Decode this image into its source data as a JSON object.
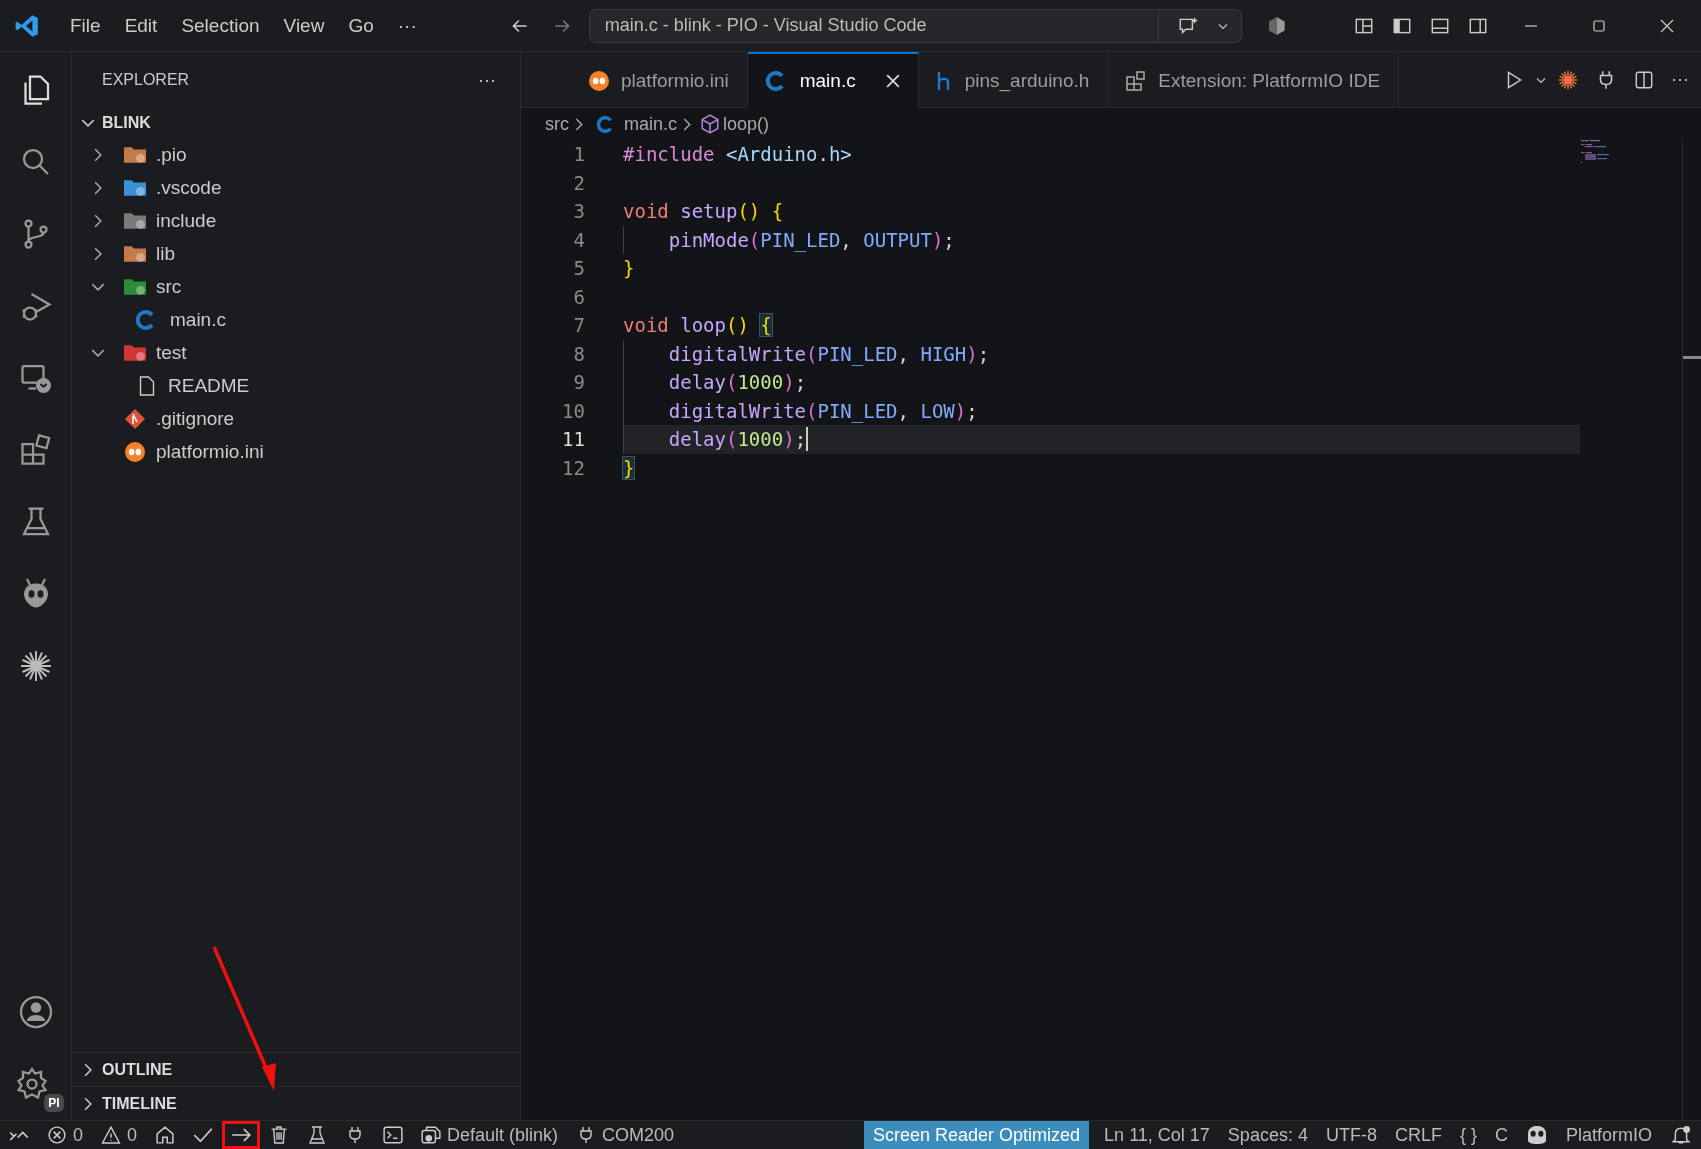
{
  "window": {
    "title": "main.c - blink - PIO - Visual Studio Code"
  },
  "menu": [
    "File",
    "Edit",
    "Selection",
    "View",
    "Go",
    "···"
  ],
  "sidebar": {
    "title": "EXPLORER",
    "more": "···",
    "root": {
      "label": "BLINK",
      "expanded": true
    },
    "items": [
      {
        "label": ".pio",
        "kind": "pio",
        "expanded": false
      },
      {
        "label": ".vscode",
        "kind": "vscode",
        "expanded": false
      },
      {
        "label": "include",
        "kind": "include",
        "expanded": false
      },
      {
        "label": "lib",
        "kind": "lib",
        "expanded": false
      },
      {
        "label": "src",
        "kind": "src",
        "expanded": true,
        "children": [
          {
            "label": "main.c",
            "kind": "c"
          }
        ]
      },
      {
        "label": "test",
        "kind": "test",
        "expanded": true,
        "children": [
          {
            "label": "README",
            "kind": "file"
          }
        ]
      },
      {
        "label": ".gitignore",
        "kind": "git"
      },
      {
        "label": "platformio.ini",
        "kind": "ini"
      }
    ],
    "sections": [
      {
        "label": "OUTLINE",
        "expanded": false
      },
      {
        "label": "TIMELINE",
        "expanded": false
      }
    ]
  },
  "tabs": [
    {
      "label": "platformio.ini",
      "kind": "ini",
      "selected": false
    },
    {
      "label": "main.c",
      "kind": "c",
      "selected": true
    },
    {
      "label": "pins_arduino.h",
      "kind": "h",
      "selected": false
    },
    {
      "label": "Extension: PlatformIO IDE",
      "kind": "ext",
      "selected": false
    }
  ],
  "more_actions": "···",
  "breadcrumb": [
    {
      "label": "src",
      "kind": "folder"
    },
    {
      "label": "main.c",
      "kind": "c"
    },
    {
      "label": "loop()",
      "kind": "symbol"
    }
  ],
  "code": [
    {
      "line_number": "1",
      "indented": false,
      "current": false,
      "tokens": [
        {
          "text": "#include ",
          "kind": "directive"
        },
        {
          "text": "<Arduino.h>",
          "kind": "header"
        }
      ]
    },
    {
      "line_number": "2",
      "indented": false,
      "current": false
    },
    {
      "line_number": "3",
      "indented": false,
      "current": false,
      "tokens": [
        {
          "text": "void ",
          "kind": "keyword"
        },
        {
          "text": "setup",
          "kind": "function"
        },
        {
          "text": "() ",
          "kind": "bracket1"
        },
        {
          "text": "{",
          "kind": "bracket1"
        }
      ]
    },
    {
      "line_number": "4",
      "indented": true,
      "current": false,
      "tokens": [
        {
          "text": "pinMode",
          "kind": "function"
        },
        {
          "text": "(",
          "kind": "bracket2"
        },
        {
          "text": "PIN_LED",
          "kind": "macro"
        },
        {
          "text": ", ",
          "kind": "punct"
        },
        {
          "text": "OUTPUT",
          "kind": "macro"
        },
        {
          "text": ")",
          "kind": "bracket2"
        },
        {
          "text": ";",
          "kind": "punct"
        }
      ]
    },
    {
      "line_number": "5",
      "indented": false,
      "current": false,
      "tokens": [
        {
          "text": "}",
          "kind": "bracket1"
        }
      ]
    },
    {
      "line_number": "6",
      "indented": false,
      "current": false
    },
    {
      "line_number": "7",
      "indented": false,
      "current": false,
      "tokens": [
        {
          "text": "void ",
          "kind": "keyword"
        },
        {
          "text": "loop",
          "kind": "function"
        },
        {
          "text": "() ",
          "kind": "bracket1"
        },
        {
          "text": "{",
          "kind": "match"
        }
      ]
    },
    {
      "line_number": "8",
      "indented": true,
      "current": false,
      "tokens": [
        {
          "text": "digitalWrite",
          "kind": "function"
        },
        {
          "text": "(",
          "kind": "bracket2"
        },
        {
          "text": "PIN_LED",
          "kind": "macro"
        },
        {
          "text": ", ",
          "kind": "punct"
        },
        {
          "text": "HIGH",
          "kind": "macro"
        },
        {
          "text": ")",
          "kind": "bracket2"
        },
        {
          "text": ";",
          "kind": "punct"
        }
      ]
    },
    {
      "line_number": "9",
      "indented": true,
      "current": false,
      "tokens": [
        {
          "text": "delay",
          "kind": "function"
        },
        {
          "text": "(",
          "kind": "bracket2"
        },
        {
          "text": "1000",
          "kind": "number"
        },
        {
          "text": ")",
          "kind": "bracket2"
        },
        {
          "text": ";",
          "kind": "punct"
        }
      ]
    },
    {
      "line_number": "10",
      "indented": true,
      "current": false,
      "tokens": [
        {
          "text": "digitalWrite",
          "kind": "function"
        },
        {
          "text": "(",
          "kind": "bracket2"
        },
        {
          "text": "PIN_LED",
          "kind": "macro"
        },
        {
          "text": ", ",
          "kind": "punct"
        },
        {
          "text": "LOW",
          "kind": "macro"
        },
        {
          "text": ")",
          "kind": "bracket2"
        },
        {
          "text": ";",
          "kind": "punct"
        }
      ]
    },
    {
      "line_number": "11",
      "indented": true,
      "current": true,
      "tokens": [
        {
          "text": "delay",
          "kind": "function"
        },
        {
          "text": "(",
          "kind": "bracket2"
        },
        {
          "text": "1000",
          "kind": "number"
        },
        {
          "text": ")",
          "kind": "bracket2"
        },
        {
          "text": ";",
          "kind": "punct"
        }
      ]
    },
    {
      "line_number": "12",
      "indented": false,
      "current": false,
      "tokens": [
        {
          "text": "}",
          "kind": "match"
        }
      ]
    }
  ],
  "status_bar": {
    "left": [
      {
        "kind": "remote",
        "highlighted": false
      },
      {
        "kind": "errors",
        "text": "0",
        "highlighted": false
      },
      {
        "kind": "warnings",
        "text": "0",
        "highlighted": false
      },
      {
        "kind": "home",
        "highlighted": false
      },
      {
        "kind": "build",
        "highlighted": false
      },
      {
        "kind": "upload",
        "highlighted": true
      },
      {
        "kind": "clean",
        "highlighted": false
      },
      {
        "kind": "test",
        "highlighted": false
      },
      {
        "kind": "monitor",
        "highlighted": false
      },
      {
        "kind": "terminal",
        "highlighted": false
      },
      {
        "kind": "env",
        "text": "Default (blink)",
        "highlighted": false
      },
      {
        "kind": "port",
        "text": "COM200",
        "highlighted": false
      }
    ],
    "right": [
      {
        "kind": "accent",
        "text": "Screen Reader Optimized"
      },
      {
        "kind": "text",
        "text": "Ln 11, Col 17"
      },
      {
        "kind": "text",
        "text": "Spaces: 4"
      },
      {
        "kind": "text",
        "text": "UTF-8"
      },
      {
        "kind": "text",
        "text": "CRLF"
      },
      {
        "kind": "text",
        "text": "{ }"
      },
      {
        "kind": "text",
        "text": "C"
      },
      {
        "kind": "copilot"
      },
      {
        "kind": "text",
        "text": "PlatformIO"
      },
      {
        "kind": "bell"
      }
    ]
  },
  "settings_badge": "PI"
}
